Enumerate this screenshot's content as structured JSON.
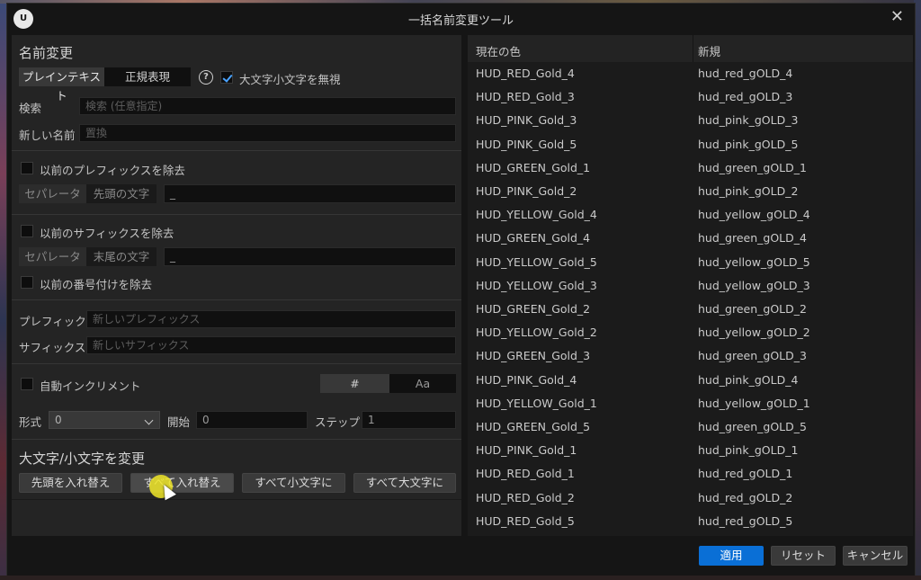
{
  "window": {
    "title": "一括名前変更ツール",
    "logo_text": "U",
    "close_glyph": "✕"
  },
  "rename": {
    "section_title": "名前変更",
    "mode_plain": "プレインテキスト",
    "mode_regex": "正規表現",
    "help_glyph": "?",
    "ignore_case_label": "大文字小文字を無視",
    "ignore_case_checked": true,
    "search_label": "検索",
    "search_placeholder": "検索 (任意指定)",
    "newname_label": "新しい名前",
    "newname_placeholder": "置換"
  },
  "remove_prefix": {
    "label": "以前のプレフィックスを除去",
    "separator_tab": "セパレータ",
    "chars_tab": "先頭の文字",
    "value": "_"
  },
  "remove_suffix": {
    "label": "以前のサフィックスを除去",
    "separator_tab": "セパレータ",
    "chars_tab": "末尾の文字",
    "value": "_"
  },
  "remove_numbering_label": "以前の番号付けを除去",
  "add": {
    "prefix_label": "プレフィック.",
    "prefix_placeholder": "新しいプレフィックス",
    "suffix_label": "サフィックス",
    "suffix_placeholder": "新しいサフィックス"
  },
  "auto_increment": {
    "label": "自動インクリメント",
    "toggle_hash": "#",
    "toggle_aa": "Aa",
    "format_label": "形式",
    "format_value": "0",
    "start_label": "開始",
    "start_value": "0",
    "step_label": "ステップ",
    "step_value": "1"
  },
  "case": {
    "section_title": "大文字/小文字を変更",
    "btn_swap_first": "先頭を入れ替え",
    "btn_swap_all": "すべて入れ替え",
    "btn_lower": "すべて小文字に",
    "btn_upper": "すべて大文字に"
  },
  "table": {
    "col_current": "現在の色",
    "col_new": "新規",
    "rows": [
      [
        "HUD_RED_Gold_4",
        "hud_red_gOLD_4"
      ],
      [
        "HUD_RED_Gold_3",
        "hud_red_gOLD_3"
      ],
      [
        "HUD_PINK_Gold_3",
        "hud_pink_gOLD_3"
      ],
      [
        "HUD_PINK_Gold_5",
        "hud_pink_gOLD_5"
      ],
      [
        "HUD_GREEN_Gold_1",
        "hud_green_gOLD_1"
      ],
      [
        "HUD_PINK_Gold_2",
        "hud_pink_gOLD_2"
      ],
      [
        "HUD_YELLOW_Gold_4",
        "hud_yellow_gOLD_4"
      ],
      [
        "HUD_GREEN_Gold_4",
        "hud_green_gOLD_4"
      ],
      [
        "HUD_YELLOW_Gold_5",
        "hud_yellow_gOLD_5"
      ],
      [
        "HUD_YELLOW_Gold_3",
        "hud_yellow_gOLD_3"
      ],
      [
        "HUD_GREEN_Gold_2",
        "hud_green_gOLD_2"
      ],
      [
        "HUD_YELLOW_Gold_2",
        "hud_yellow_gOLD_2"
      ],
      [
        "HUD_GREEN_Gold_3",
        "hud_green_gOLD_3"
      ],
      [
        "HUD_PINK_Gold_4",
        "hud_pink_gOLD_4"
      ],
      [
        "HUD_YELLOW_Gold_1",
        "hud_yellow_gOLD_1"
      ],
      [
        "HUD_GREEN_Gold_5",
        "hud_green_gOLD_5"
      ],
      [
        "HUD_PINK_Gold_1",
        "hud_pink_gOLD_1"
      ],
      [
        "HUD_RED_Gold_1",
        "hud_red_gOLD_1"
      ],
      [
        "HUD_RED_Gold_2",
        "hud_red_gOLD_2"
      ],
      [
        "HUD_RED_Gold_5",
        "hud_red_gOLD_5"
      ]
    ]
  },
  "footer": {
    "apply": "適用",
    "reset": "リセット",
    "cancel": "キャンセル"
  },
  "colors": {
    "accent": "#0a6fd6",
    "check": "#4aa3ff",
    "cursor_highlight": "#f0e628"
  }
}
